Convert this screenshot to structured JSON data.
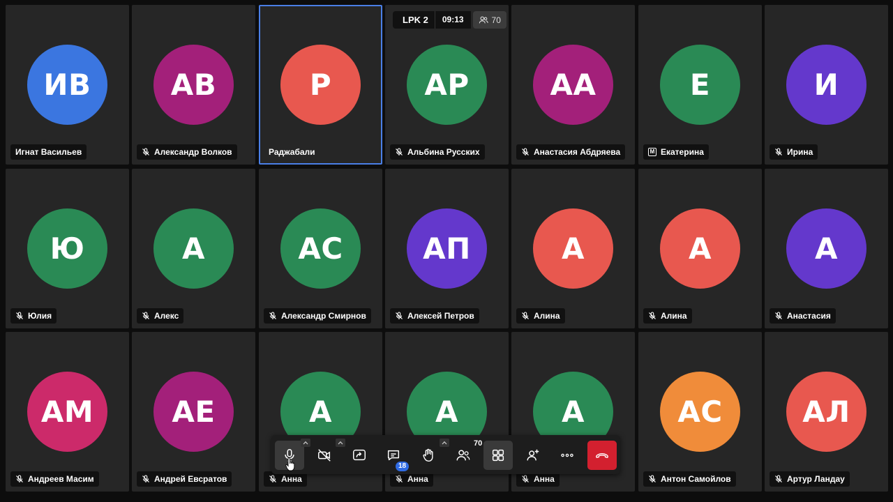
{
  "meeting": {
    "title": "LPK 2",
    "time": "09:13",
    "participant_count": "70"
  },
  "participants": [
    {
      "initials": "ИВ",
      "name": "Игнат Васильев",
      "color": "#3b76e0",
      "icon": "none",
      "active": false
    },
    {
      "initials": "АВ",
      "name": "Александр Волков",
      "color": "#a3207a",
      "icon": "mic-muted",
      "active": false
    },
    {
      "initials": "Р",
      "name": "Раджабали",
      "color": "#e8584f",
      "icon": "none",
      "active": true
    },
    {
      "initials": "АР",
      "name": "Альбина Русских",
      "color": "#2a8a55",
      "icon": "mic-muted",
      "active": false
    },
    {
      "initials": "АА",
      "name": "Анастасия Абдряева",
      "color": "#a3207a",
      "icon": "mic-muted",
      "active": false
    },
    {
      "initials": "Е",
      "name": "Екатерина",
      "color": "#2a8a55",
      "icon": "m-box",
      "active": false
    },
    {
      "initials": "И",
      "name": "Ирина",
      "color": "#6438cc",
      "icon": "mic-muted",
      "active": false
    },
    {
      "initials": "Ю",
      "name": "Юлия",
      "color": "#2a8a55",
      "icon": "mic-muted",
      "active": false
    },
    {
      "initials": "А",
      "name": "Алекс",
      "color": "#2a8a55",
      "icon": "mic-muted",
      "active": false
    },
    {
      "initials": "АС",
      "name": "Александр Смирнов",
      "color": "#2a8a55",
      "icon": "mic-muted",
      "active": false
    },
    {
      "initials": "АП",
      "name": "Алексей Петров",
      "color": "#6438cc",
      "icon": "mic-muted",
      "active": false
    },
    {
      "initials": "А",
      "name": "Алина",
      "color": "#e8584f",
      "icon": "mic-muted",
      "active": false
    },
    {
      "initials": "А",
      "name": "Алина",
      "color": "#e8584f",
      "icon": "mic-muted",
      "active": false
    },
    {
      "initials": "А",
      "name": "Анастасия",
      "color": "#6438cc",
      "icon": "mic-muted",
      "active": false
    },
    {
      "initials": "АМ",
      "name": "Андреев Масим",
      "color": "#cc2a6a",
      "icon": "mic-muted",
      "active": false
    },
    {
      "initials": "АЕ",
      "name": "Андрей Евсратов",
      "color": "#a3207a",
      "icon": "mic-muted",
      "active": false
    },
    {
      "initials": "А",
      "name": "Анна",
      "color": "#2a8a55",
      "icon": "mic-muted",
      "active": false
    },
    {
      "initials": "А",
      "name": "Анна",
      "color": "#2a8a55",
      "icon": "mic-muted",
      "active": false
    },
    {
      "initials": "А",
      "name": "Анна",
      "color": "#2a8a55",
      "icon": "mic-muted",
      "active": false
    },
    {
      "initials": "АС",
      "name": "Антон Самойлов",
      "color": "#f08c3a",
      "icon": "mic-muted",
      "active": false
    },
    {
      "initials": "АЛ",
      "name": "Артур Ландау",
      "color": "#e8584f",
      "icon": "mic-muted",
      "active": false
    }
  ],
  "toolbar": {
    "buttons": [
      {
        "name": "mic-button",
        "icon": "mic-icon",
        "caret": true,
        "selected": true
      },
      {
        "name": "camera-button",
        "icon": "camera-off-icon",
        "caret": true
      },
      {
        "name": "share-button",
        "icon": "share-screen-icon"
      },
      {
        "name": "chat-button",
        "icon": "chat-icon",
        "badge": "18"
      },
      {
        "name": "raise-hand-button",
        "icon": "hand-icon",
        "caret": true
      },
      {
        "name": "participants-button",
        "icon": "people-icon",
        "count": "70"
      },
      {
        "name": "layout-button",
        "icon": "grid-icon",
        "selected": true
      },
      {
        "name": "invite-button",
        "icon": "add-person-icon"
      },
      {
        "name": "more-button",
        "icon": "more-icon"
      },
      {
        "name": "leave-button",
        "icon": "hang-up-icon",
        "danger": true
      }
    ],
    "end_color": "#d3202f",
    "badge_color": "#2f6be3"
  }
}
